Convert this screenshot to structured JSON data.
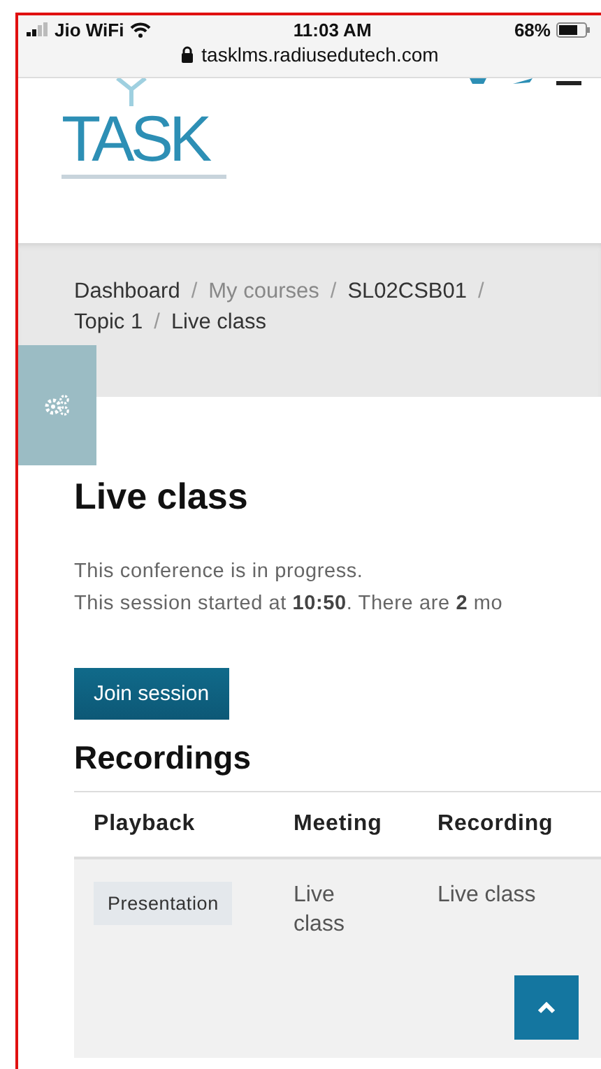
{
  "status_bar": {
    "carrier": "Jio WiFi",
    "time": "11:03 AM",
    "battery": "68%"
  },
  "address_bar": {
    "url": "tasklms.radiusedutech.com"
  },
  "header": {
    "logo": "TASK"
  },
  "breadcrumb": [
    {
      "label": "Dashboard",
      "kind": "link"
    },
    {
      "separator": "/",
      "label": "My courses",
      "kind": "muted"
    },
    {
      "separator": "/",
      "label": "SL02CSB01",
      "kind": "link"
    },
    {
      "separator": "/",
      "label": "Topic 1",
      "kind": "link"
    },
    {
      "separator": "/",
      "label": "Live class",
      "kind": "link"
    }
  ],
  "page": {
    "title": "Live class",
    "messages": [
      "This conference is in progress.",
      "This session started at **10:50**. There are **2** mo"
    ],
    "join_button": "Join session",
    "recordings_heading": "Recordings"
  },
  "table": {
    "columns": [
      "Playback",
      "Meeting",
      "Recording"
    ],
    "rows": [
      {
        "playback": "Presentation",
        "meeting": "Live class",
        "recording": "Live class"
      }
    ]
  }
}
